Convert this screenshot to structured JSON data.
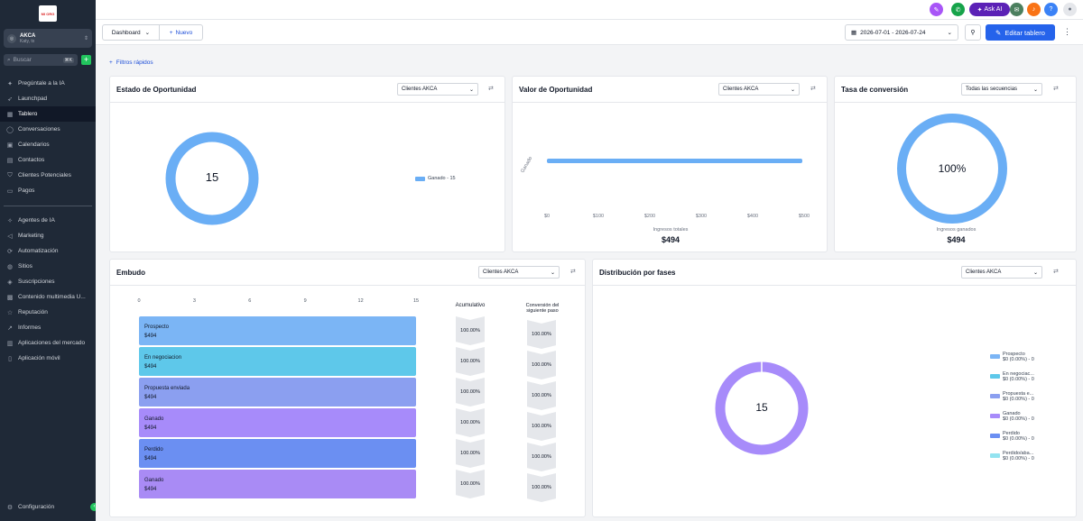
{
  "sidebar": {
    "logo_text": "MI ORG",
    "account": {
      "name": "AKCA",
      "location": "Katy, tx"
    },
    "search": {
      "placeholder": "Buscar",
      "shortcut": "⌘K"
    },
    "items": [
      {
        "label": "Pregúntale a la IA",
        "icon": "sparkle-icon"
      },
      {
        "label": "Launchpad",
        "icon": "rocket-icon"
      },
      {
        "label": "Tablero",
        "icon": "dashboard-icon",
        "active": true
      },
      {
        "label": "Conversaciones",
        "icon": "chat-icon"
      },
      {
        "label": "Calendarios",
        "icon": "calendar-icon"
      },
      {
        "label": "Contactos",
        "icon": "contacts-icon"
      },
      {
        "label": "Clientes Potenciales",
        "icon": "funnel-icon"
      },
      {
        "label": "Pagos",
        "icon": "payments-icon"
      }
    ],
    "items2": [
      {
        "label": "Agentes de IA",
        "icon": "robot-icon"
      },
      {
        "label": "Marketing",
        "icon": "megaphone-icon"
      },
      {
        "label": "Automatización",
        "icon": "automation-icon"
      },
      {
        "label": "Sitios",
        "icon": "globe-icon"
      },
      {
        "label": "Suscripciones",
        "icon": "subscription-icon"
      },
      {
        "label": "Contenido multimedia U...",
        "icon": "media-icon"
      },
      {
        "label": "Reputación",
        "icon": "star-icon"
      },
      {
        "label": "Informes",
        "icon": "chart-icon"
      },
      {
        "label": "Aplicaciones del mercado",
        "icon": "apps-icon"
      },
      {
        "label": "Aplicación móvil",
        "icon": "mobile-icon"
      }
    ],
    "settings": "Configuración"
  },
  "topbar": {
    "ask_ai": "Ask AI"
  },
  "toolbar": {
    "dashboard_select": "Dashboard",
    "new_button": "Nuevo",
    "date_range": "2026-07-01 - 2026-07-24",
    "edit_button": "Editar tablero",
    "quick_filters": "Filtros rápidos"
  },
  "cards": {
    "estado": {
      "title": "Estado de Oportunidad",
      "filter": "Clientes AKCA",
      "center": "15",
      "legend": "Ganado - 15"
    },
    "valor": {
      "title": "Valor de Oportunidad",
      "filter": "Clientes AKCA",
      "ylabel": "Ganado",
      "ticks": [
        "$0",
        "$100",
        "$200",
        "$300",
        "$400",
        "$500"
      ],
      "footer_label": "Ingresos totales",
      "footer_value": "$494"
    },
    "tasa": {
      "title": "Tasa de conversión",
      "filter": "Todas las secuencias",
      "center": "100%",
      "footer_label": "Ingresos ganados",
      "footer_value": "$494"
    },
    "embudo": {
      "title": "Embudo",
      "filter": "Clientes AKCA",
      "axis": [
        "0",
        "3",
        "6",
        "9",
        "12",
        "15"
      ],
      "col1": "Acumulativo",
      "col2": "Conversión del siguiente paso",
      "stages": [
        {
          "name": "Prospecto",
          "value": "$494",
          "acc": "100.00%",
          "conv": "100.00%",
          "color": "#7bb5f5"
        },
        {
          "name": "En negociacion",
          "value": "$494",
          "acc": "100.00%",
          "conv": "100.00%",
          "color": "#5ec8ea"
        },
        {
          "name": "Propuesta enviada",
          "value": "$494",
          "acc": "100.00%",
          "conv": "100.00%",
          "color": "#8b9ff0"
        },
        {
          "name": "Ganado",
          "value": "$494",
          "acc": "100.00%",
          "conv": "100.00%",
          "color": "#a78bfa"
        },
        {
          "name": "Perdido",
          "value": "$494",
          "acc": "100.00%",
          "conv": "100.00%",
          "color": "#6b8ff2"
        },
        {
          "name": "Ganado",
          "value": "$494",
          "acc": "100.00%",
          "conv": "100.00%",
          "color": "#a98bf5"
        }
      ]
    },
    "distribucion": {
      "title": "Distribución por fases",
      "filter": "Clientes AKCA",
      "center": "15",
      "legend": [
        {
          "name": "Prospecto",
          "value": "$0 (0.00%) - 0",
          "color": "#7bb5f5"
        },
        {
          "name": "En negociac...",
          "value": "$0 (0.00%) - 0",
          "color": "#5ec8ea"
        },
        {
          "name": "Propuesta e...",
          "value": "$0 (0.00%) - 0",
          "color": "#8b9ff0"
        },
        {
          "name": "Ganado",
          "value": "$0 (0.00%) - 0",
          "color": "#a78bfa"
        },
        {
          "name": "Perdido",
          "value": "$0 (0.00%) - 0",
          "color": "#6b8ff2"
        },
        {
          "name": "Perdido/aba...",
          "value": "$0 (0.00%) - 0",
          "color": "#93e3f0"
        }
      ]
    }
  },
  "colors": {
    "accent": "#2563eb",
    "donut_blue": "#6aaef5",
    "donut_purple": "#a78bfa",
    "sidebar": "#1f2937"
  }
}
